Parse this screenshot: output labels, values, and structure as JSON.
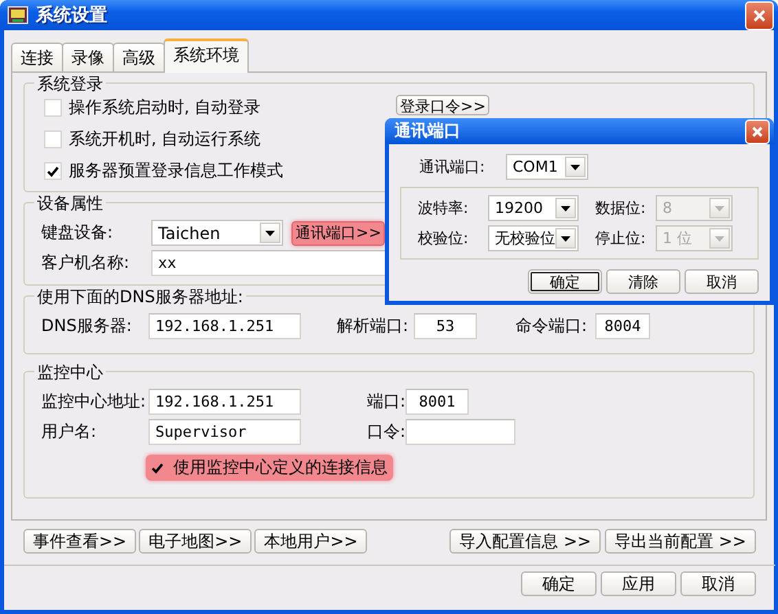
{
  "window": {
    "title": "系统设置"
  },
  "tabs": [
    {
      "label": "连接",
      "selected": false
    },
    {
      "label": "录像",
      "selected": false
    },
    {
      "label": "高级",
      "selected": false
    },
    {
      "label": "系统环境",
      "selected": true
    }
  ],
  "login_group": {
    "title": "系统登录",
    "options": [
      {
        "label": "操作系统启动时, 自动登录",
        "checked": false
      },
      {
        "label": "系统开机时, 自动运行系统",
        "checked": false
      },
      {
        "label": "服务器预置登录信息工作模式",
        "checked": true
      }
    ],
    "password_button": "登录口令>>"
  },
  "device_group": {
    "title": "设备属性",
    "keyboard": {
      "label": "键盘设备:",
      "value": "Taichen"
    },
    "port_button": {
      "label": "通讯端口>>",
      "highlighted": true
    },
    "client_name": {
      "label": "客户机名称:",
      "value": "xx"
    }
  },
  "dns_group": {
    "title": "使用下面的DNS服务器地址:",
    "fields": [
      {
        "label": "DNS服务器:",
        "value": "192.168.1.251"
      },
      {
        "label": "解析端口:",
        "value": "53"
      },
      {
        "label": "命令端口:",
        "value": "8004"
      }
    ]
  },
  "monitor_group": {
    "title": "监控中心",
    "address": {
      "label": "监控中心地址:",
      "value": "192.168.1.251"
    },
    "port": {
      "label": "端口:",
      "value": "8001"
    },
    "username": {
      "label": "用户名:",
      "value": "Supervisor"
    },
    "password": {
      "label": "口令:"
    },
    "use_center": {
      "label": "使用监控中心定义的连接信息",
      "checked": true,
      "highlighted": true
    }
  },
  "tool_buttons_left": [
    "事件查看>>",
    "电子地图>>",
    "本地用户>>"
  ],
  "tool_buttons_right": [
    "导入配置信息 >>",
    "导出当前配置 >>"
  ],
  "buttons": [
    "确定",
    "应用",
    "取消"
  ],
  "dialog": {
    "title": "通讯端口",
    "port": {
      "label": "通讯端口:",
      "value": "COM1"
    },
    "rows": [
      {
        "left": {
          "label": "波特率:",
          "value": "19200",
          "disabled": false
        },
        "right": {
          "label": "数据位:",
          "value": "8",
          "disabled": true
        }
      },
      {
        "left": {
          "label": "校验位:",
          "value": "无校验位",
          "disabled": false
        },
        "right": {
          "label": "停止位:",
          "value": "1 位",
          "disabled": true
        }
      }
    ],
    "buttons": [
      {
        "label": "确定",
        "default": true
      },
      {
        "label": "清除",
        "default": false
      },
      {
        "label": "取消",
        "default": false
      }
    ]
  }
}
